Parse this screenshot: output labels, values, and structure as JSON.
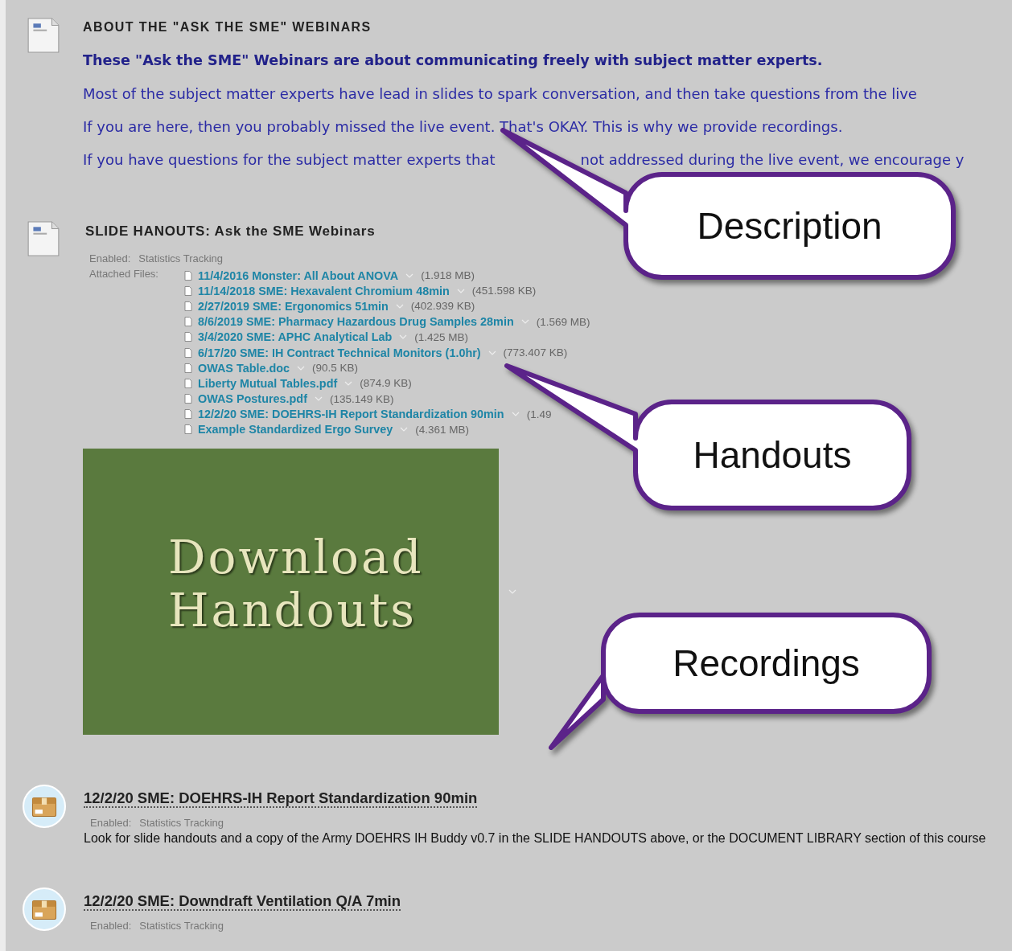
{
  "about": {
    "title": "ABOUT THE \"ASK THE SME\" WEBINARS",
    "lines": [
      {
        "text": "These \"Ask the SME\" Webinars are about communicating freely with subject matter experts.",
        "bold": true
      },
      {
        "text": "Most of the subject matter experts have lead in slides to spark conversation, and then take questions from the live",
        "bold": false
      },
      {
        "text": "If you are here, then you probably missed the live event. That's OKAY.  This is why we provide recordings.",
        "bold": false
      }
    ],
    "partial_line": [
      "If you have questions for the subject matter experts that",
      "not addressed during the live event, we encourage y"
    ]
  },
  "handouts": {
    "title": "SLIDE HANOUTS: Ask the SME Webinars",
    "enabled_label": "Enabled:",
    "enabled_value": "Statistics Tracking",
    "files_label": "Attached Files:",
    "files": [
      {
        "name": "11/4/2016 Monster: All About ANOVA",
        "size": "(1.918 MB)"
      },
      {
        "name": "11/14/2018 SME: Hexavalent Chromium 48min",
        "size": "(451.598 KB)"
      },
      {
        "name": "2/27/2019 SME: Ergonomics 51min",
        "size": "(402.939 KB)"
      },
      {
        "name": "8/6/2019 SME: Pharmacy Hazardous Drug Samples 28min",
        "size": "(1.569 MB)"
      },
      {
        "name": "3/4/2020 SME: APHC Analytical Lab",
        "size": "(1.425 MB)"
      },
      {
        "name": "6/17/20 SME: IH Contract Technical Monitors (1.0hr)",
        "size": "(773.407 KB)"
      },
      {
        "name": "OWAS Table.doc",
        "size": "(90.5 KB)"
      },
      {
        "name": "Liberty Mutual Tables.pdf",
        "size": "(874.9 KB)"
      },
      {
        "name": "OWAS Postures.pdf",
        "size": "(135.149 KB)"
      },
      {
        "name": "12/2/20 SME: DOEHRS-IH Report Standardization 90min",
        "size": "(1.49"
      },
      {
        "name": "Example Standardized Ergo Survey",
        "size": "(4.361 MB)"
      }
    ],
    "banner": [
      "Download",
      "Handouts"
    ]
  },
  "recordings": [
    {
      "title": "12/2/20 SME: DOEHRS-IH Report Standardization 90min",
      "enabled_label": "Enabled:",
      "enabled_value": "Statistics Tracking",
      "description": "Look for slide handouts and a copy of the Army DOEHRS IH Buddy v0.7 in the SLIDE HANDOUTS above, or the DOCUMENT LIBRARY section of this course"
    },
    {
      "title": "12/2/20 SME: Downdraft Ventilation Q/A 7min",
      "enabled_label": "Enabled:",
      "enabled_value": "Statistics Tracking"
    }
  ],
  "callouts": [
    {
      "label": "Description"
    },
    {
      "label": "Handouts"
    },
    {
      "label": "Recordings"
    }
  ]
}
